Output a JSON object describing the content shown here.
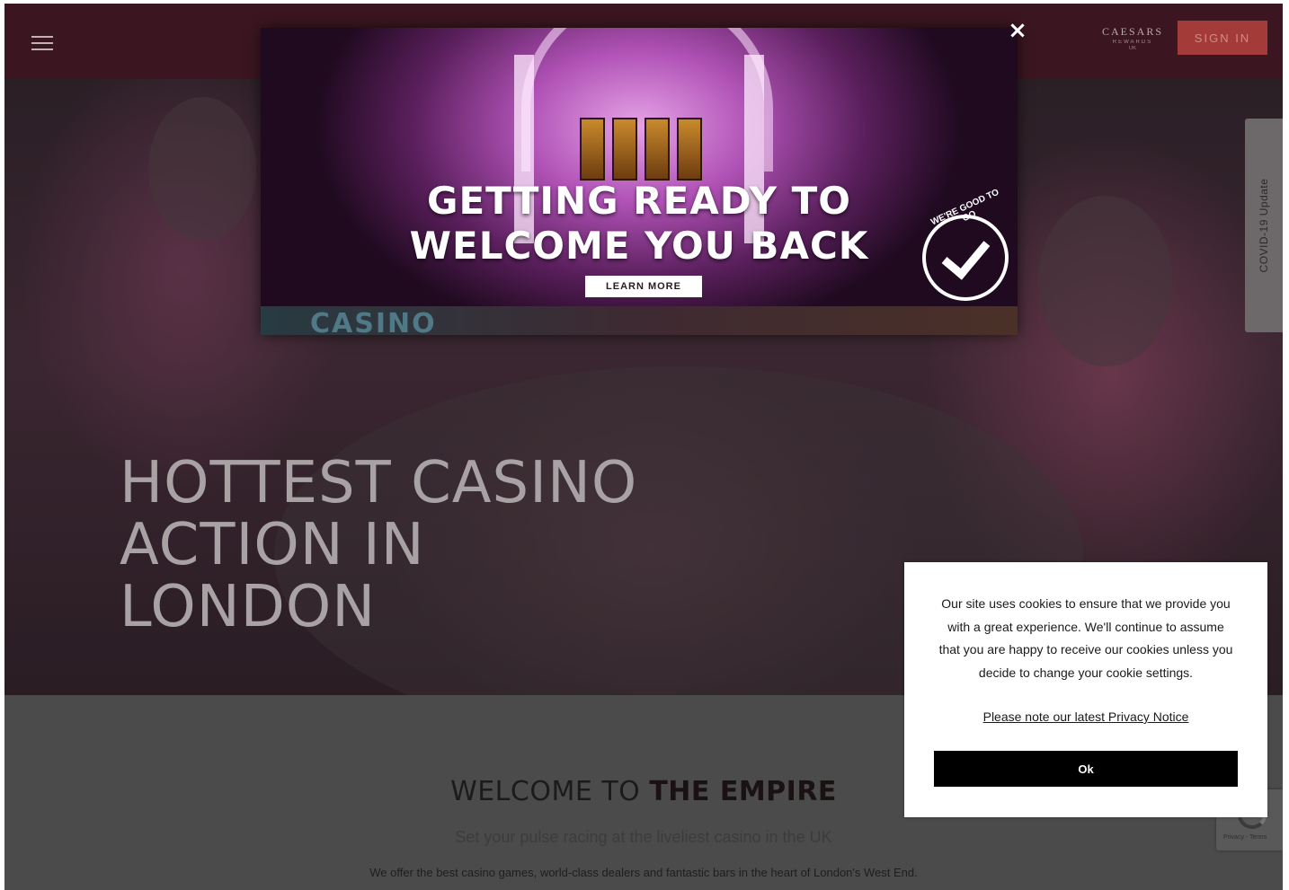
{
  "header": {
    "logo_line1": "CAESARS",
    "logo_line2": "REWARDS",
    "logo_line3": "UK",
    "sign_in_label": "SIGN IN"
  },
  "hero": {
    "title_lines": [
      "HOTTEST CASINO",
      "ACTION IN",
      "LONDON"
    ]
  },
  "side_tab": {
    "label": "COVID-19 Update"
  },
  "popup": {
    "title_line1": "GETTING READY TO",
    "title_line2": "WELCOME YOU BACK",
    "learn_more_label": "LEARN MORE",
    "badge_text": "WE'RE GOOD TO GO",
    "bottom_text": "CASINO",
    "close_label": "×"
  },
  "welcome": {
    "title_prefix": "WELCOME TO ",
    "title_emphasis": "THE EMPIRE",
    "subtitle": "Set your pulse racing at the liveliest casino in the UK",
    "body": "We offer the best casino games, world-class dealers and fantastic bars in the heart of London's West End."
  },
  "cookie": {
    "text": "Our site uses cookies to ensure that we provide you with a great experience. We'll continue to assume that you are happy to receive our cookies unless you decide to change your cookie settings.",
    "privacy_link": "Please note our latest Privacy Notice",
    "ok_label": "Ok"
  },
  "recaptcha": {
    "text": "Privacy - Terms"
  },
  "icons": {
    "menu": "hamburger-menu-icon",
    "close": "close-icon",
    "check": "checkmark-badge-icon",
    "recaptcha": "recaptcha-icon"
  },
  "colors": {
    "header_bg": "#3b1620",
    "sign_in_bg": "#a33b38",
    "cookie_button_bg": "#000000",
    "overlay": "#4a4a4a"
  }
}
